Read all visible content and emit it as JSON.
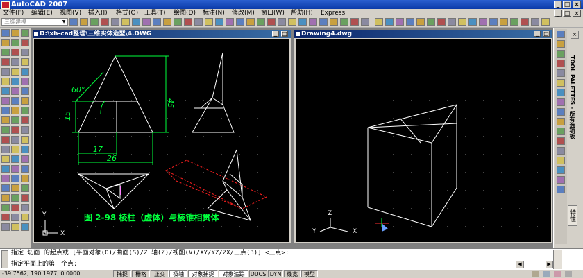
{
  "app": {
    "title": "AutoCAD 2007"
  },
  "menu": [
    "文件(F)",
    "编辑(E)",
    "视图(V)",
    "插入(I)",
    "格式(O)",
    "工具(T)",
    "绘图(D)",
    "标注(N)",
    "修改(M)",
    "窗口(W)",
    "帮助(H)",
    "Express"
  ],
  "workspace": {
    "selected": "三维建模"
  },
  "windows": {
    "left": {
      "title": "D:\\xh-cad整理\\三维实体造型\\4.DWG"
    },
    "right": {
      "title": "Drawing4.dwg"
    }
  },
  "drawing": {
    "dims": {
      "angle": "60°",
      "h45": "45",
      "h15": "15",
      "w17": "17",
      "w26": "26"
    },
    "caption": "图 2-98  棱柱（虚体）与棱锥相贯体",
    "ucs_y": "Y",
    "ucs_x": "X",
    "ucs_z": "Z"
  },
  "tool_palette": {
    "label": "TOOL PALETTES - 所有选项板",
    "side_label": "特性"
  },
  "command": {
    "line1": "指定 切面 的起点或 [平面对象(O)/曲面(S)/Z 轴(Z)/视图(V)/XY/YZ/ZX/三点(3)] <三点>:",
    "line2": "指定平面上的第一个点:"
  },
  "status": {
    "coords": "-39.7562, 190.1977, 0.0000",
    "toggles": [
      "捕捉",
      "栅格",
      "正交",
      "极轴",
      "对象捕捉",
      "对象追踪",
      "DUCS",
      "DYN",
      "线宽",
      "模型"
    ]
  },
  "colors": {
    "drawing_green": "#00ff3c",
    "drawing_white": "#ffffff",
    "hidden_red": "#ff2020",
    "magenta": "#ff00ff",
    "ucs_red": "#ff3030",
    "ucs_blue": "#6aa0ff"
  }
}
